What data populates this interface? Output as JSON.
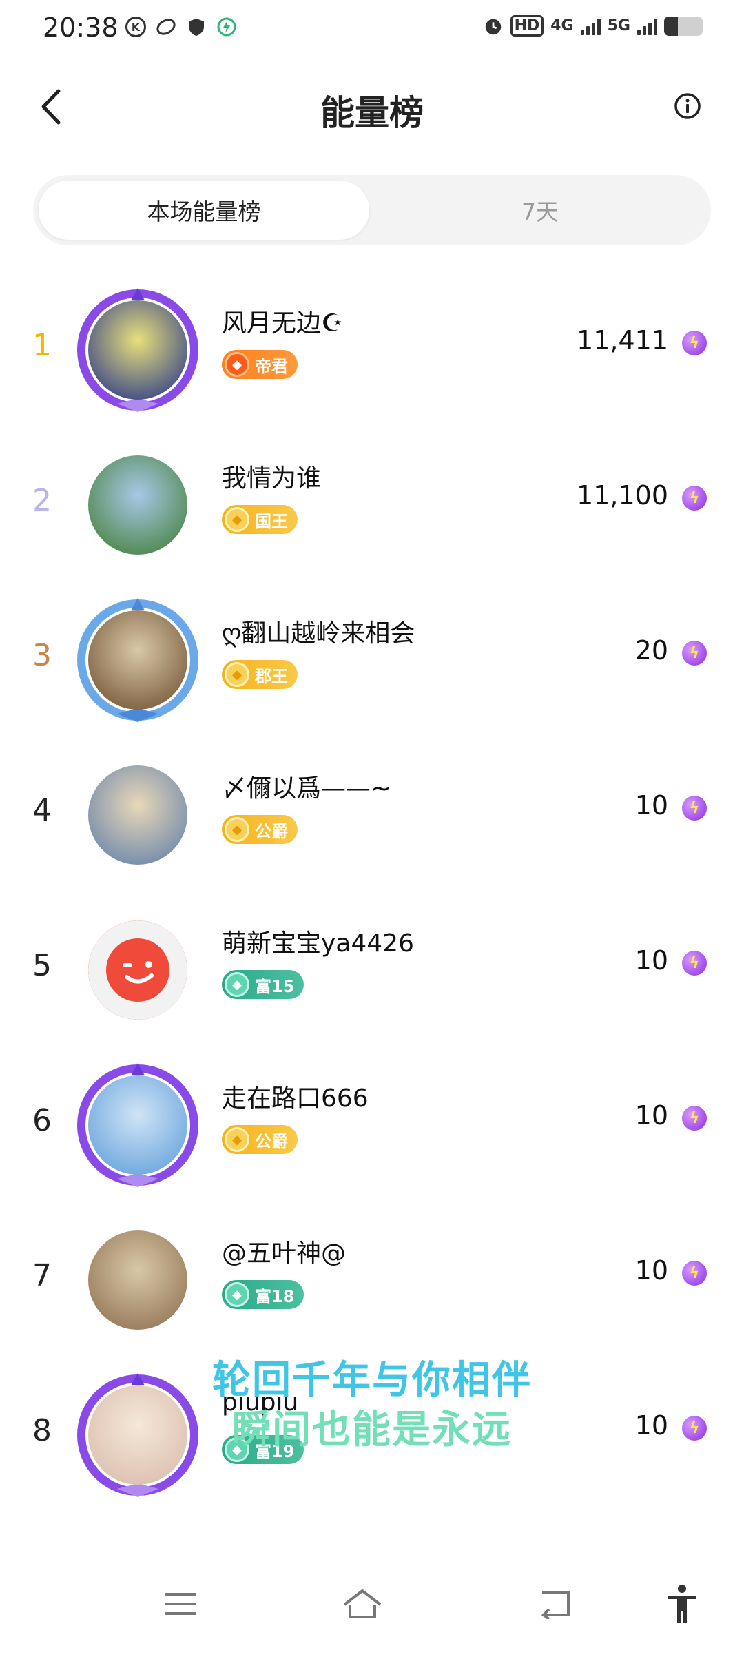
{
  "status_bar": {
    "time": "20:38",
    "hd_label": "HD",
    "net_4g": "4G",
    "net_5g": "5G",
    "battery_level": 0.35
  },
  "header": {
    "title": "能量榜",
    "back_icon": "chevron-left-icon",
    "info_icon": "info-circle-icon"
  },
  "tabs": [
    {
      "label": "本场能量榜",
      "active": true
    },
    {
      "label": "7天",
      "active": false
    }
  ],
  "ranking": [
    {
      "rank": "1",
      "rank_color": "#f4b400",
      "name": "风月无边☪",
      "badge": "帝君",
      "badge_style": "orange",
      "score": "11,411",
      "avatar_colors": [
        "#1a2a8a",
        "#e8e07a"
      ]
    },
    {
      "rank": "2",
      "rank_color": "#b9b4f0",
      "name": "我情为谁",
      "badge": "国王",
      "badge_style": "gold",
      "score": "11,100",
      "avatar_colors": [
        "#3a7a2a",
        "#a8c8e8"
      ]
    },
    {
      "rank": "3",
      "rank_color": "#c8874a",
      "name": "ღ翻山越岭来相会",
      "badge": "郡王",
      "badge_style": "gold",
      "score": "20",
      "avatar_colors": [
        "#6a4a2a",
        "#d8c8a8"
      ]
    },
    {
      "rank": "4",
      "rank_color": "#222222",
      "name": "〆儞以爲——~",
      "badge": "公爵",
      "badge_style": "gold",
      "score": "10",
      "avatar_colors": [
        "#5a7aa8",
        "#e8d8b8"
      ]
    },
    {
      "rank": "5",
      "rank_color": "#222222",
      "name": "萌新宝宝ya4426",
      "badge": "富15",
      "badge_style": "green",
      "score": "10",
      "avatar_colors": [
        "#f04a3a",
        "#f04a3a"
      ]
    },
    {
      "rank": "6",
      "rank_color": "#222222",
      "name": "走在路口666",
      "badge": "公爵",
      "badge_style": "gold",
      "score": "10",
      "avatar_colors": [
        "#5a9ad8",
        "#cfe4f6"
      ]
    },
    {
      "rank": "7",
      "rank_color": "#222222",
      "name": "@五叶神@",
      "badge": "富18",
      "badge_style": "green",
      "score": "10",
      "avatar_colors": [
        "#8a6a4a",
        "#d8c8a8"
      ]
    },
    {
      "rank": "8",
      "rank_color": "#222222",
      "name": "piupiu",
      "badge": "富19",
      "badge_style": "green",
      "score": "10",
      "avatar_colors": [
        "#d8b8a8",
        "#f4e8d8"
      ]
    }
  ],
  "caption": {
    "line1": "轮回千年与你相伴",
    "line2": "瞬间也能是永远"
  },
  "bottom_nav": [
    {
      "icon": "menu-icon"
    },
    {
      "icon": "home-icon"
    },
    {
      "icon": "back-icon"
    },
    {
      "icon": "accessibility-icon"
    }
  ]
}
